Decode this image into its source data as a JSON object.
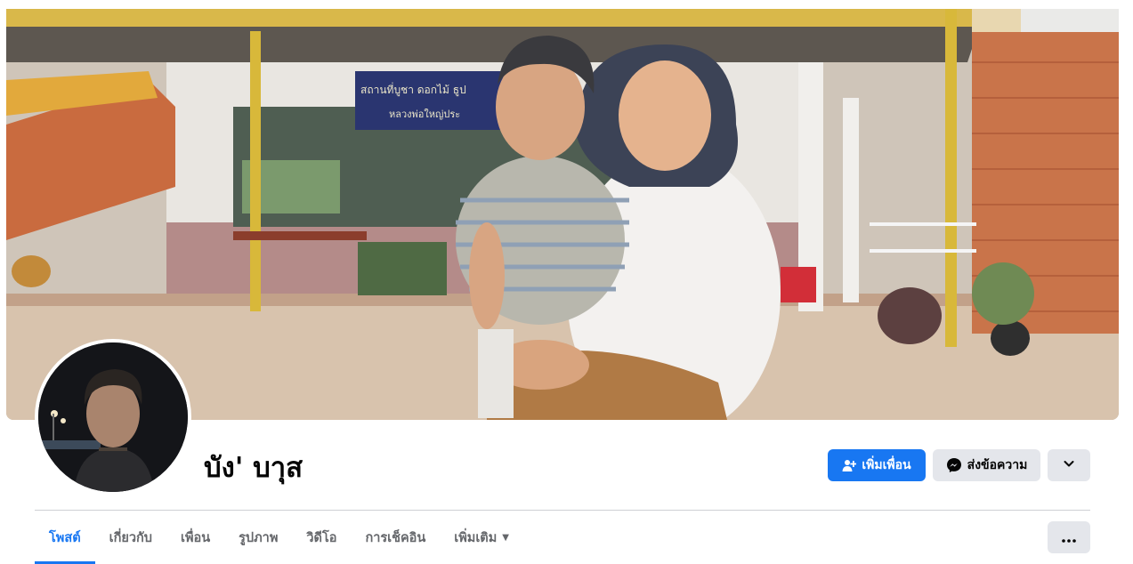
{
  "profile": {
    "name": "บัง' บาุส"
  },
  "cover": {
    "sign_line1": "สถานที่บูชา ดอกไม้ ธูป",
    "sign_line2": "หลวงพ่อใหญ่ประ"
  },
  "actions": {
    "add_friend_label": "เพิ่มเพื่อน",
    "message_label": "ส่งข้อความ",
    "more_icon": "chevron-down-icon"
  },
  "tabs": [
    {
      "label": "โพสต์",
      "active": true
    },
    {
      "label": "เกี่ยวกับ",
      "active": false
    },
    {
      "label": "เพื่อน",
      "active": false
    },
    {
      "label": "รูปภาพ",
      "active": false
    },
    {
      "label": "วิดีโอ",
      "active": false
    },
    {
      "label": "การเช็คอิน",
      "active": false
    },
    {
      "label": "เพิ่มเติม",
      "active": false
    }
  ],
  "tab_options_icon": "more-dots-icon",
  "colors": {
    "primary": "#1877f2",
    "secondary_button": "#e4e6eb",
    "tab_inactive": "#65676b"
  }
}
